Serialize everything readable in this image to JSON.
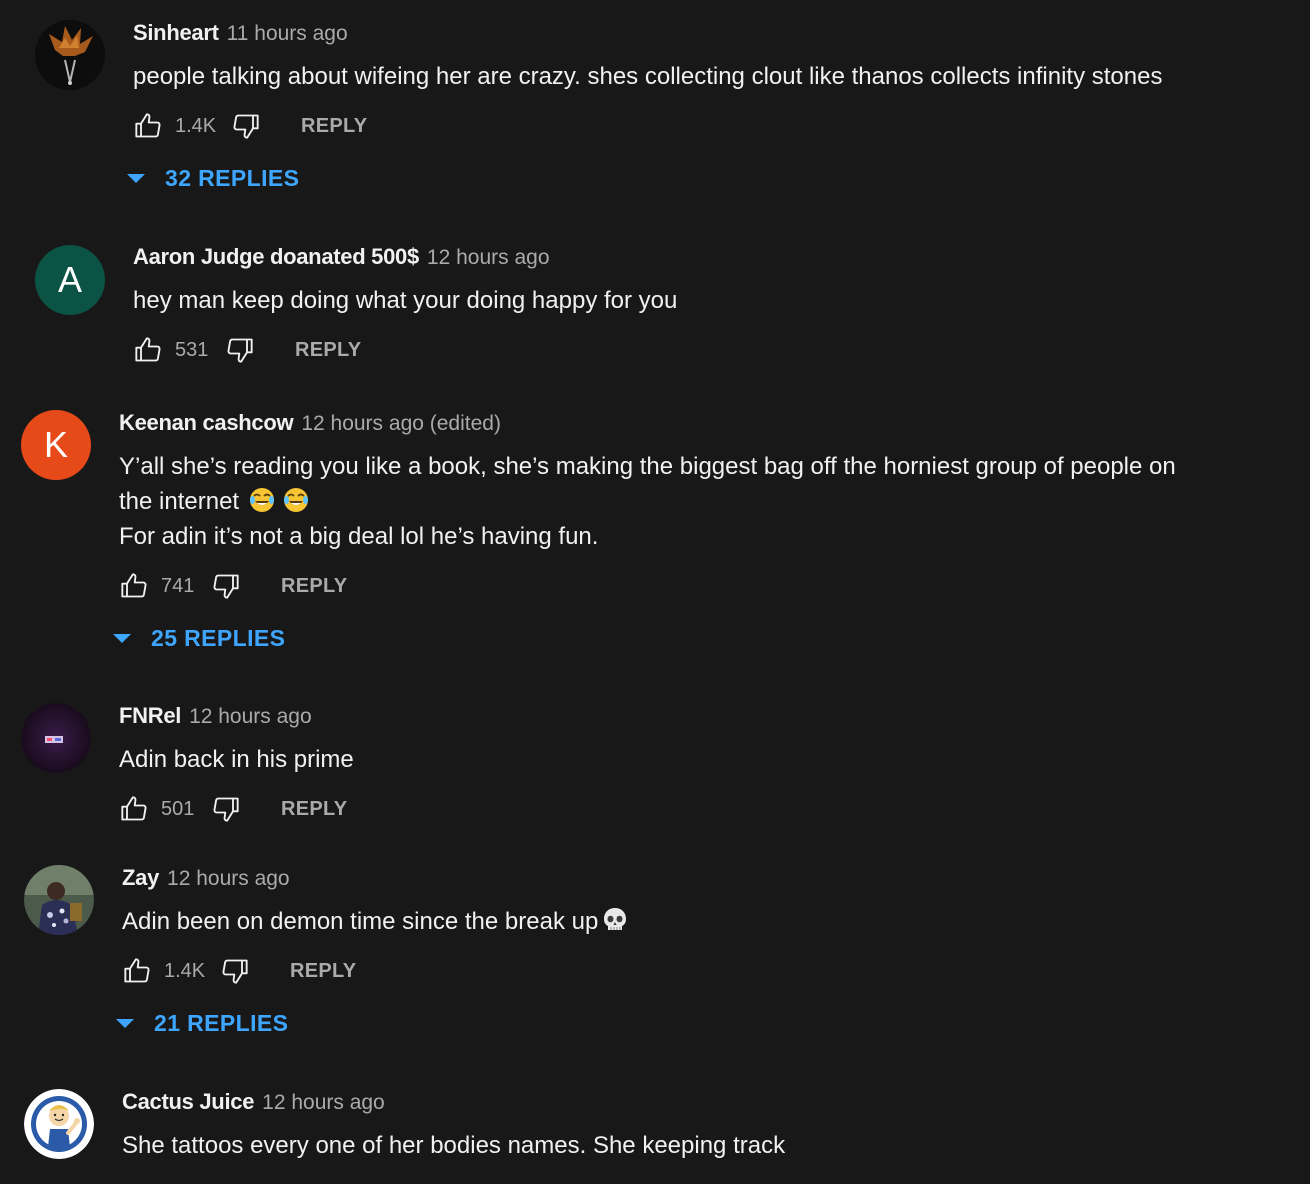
{
  "comments": [
    {
      "author": "Sinheart",
      "time": "11 hours ago",
      "lines": [
        "people talking about wifeing her are crazy. shes collecting clout like thanos collects infinity stones"
      ],
      "likes": "1.4K",
      "reply_label": "REPLY",
      "replies_label": "32 REPLIES",
      "avatar_icon": "spiky-hair-avatar"
    },
    {
      "author": "Aaron Judge doanated 500$",
      "time": "12 hours ago",
      "lines": [
        "hey man keep doing what your doing happy for you"
      ],
      "likes": "531",
      "reply_label": "REPLY",
      "avatar_letter": "A",
      "avatar_color": "#0b5345"
    },
    {
      "author": "Keenan cashcow",
      "time": "12 hours ago (edited)",
      "lines": [
        "Y’all she’s reading you like a book, she’s making the biggest bag off the horniest group of people on",
        "the internet",
        "For adin it’s not a big deal lol he’s having fun."
      ],
      "emojis": [
        "face-with-tears-of-joy",
        "face-with-tears-of-joy"
      ],
      "likes": "741",
      "reply_label": "REPLY",
      "replies_label": "25 REPLIES",
      "avatar_letter": "K",
      "avatar_color": "#e64a19"
    },
    {
      "author": "FNRel",
      "time": "12 hours ago",
      "lines": [
        "Adin back in his prime"
      ],
      "likes": "501",
      "reply_label": "REPLY",
      "avatar_icon": "dark-room-avatar"
    },
    {
      "author": "Zay",
      "time": "12 hours ago",
      "lines": [
        "Adin been on demon time since the break up"
      ],
      "emojis": [
        "skull"
      ],
      "likes": "1.4K",
      "reply_label": "REPLY",
      "replies_label": "21 REPLIES",
      "avatar_icon": "photo-avatar"
    },
    {
      "author": "Cactus Juice",
      "time": "12 hours ago",
      "lines": [
        "She tattoos every one of her bodies names. She keeping track"
      ],
      "avatar_icon": "vault-boy-avatar"
    }
  ],
  "colors": {
    "background": "#181818",
    "text_primary": "#f1f1f1",
    "text_secondary": "#aaaaaa",
    "accent_blue": "#3ea6ff"
  }
}
